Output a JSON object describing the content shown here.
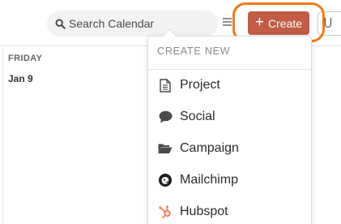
{
  "header": {
    "search": {
      "placeholder": "Search Calendar",
      "value": ""
    },
    "create_label": "Create"
  },
  "calendar": {
    "day_name": "FRIDAY",
    "day_date": "Jan 9"
  },
  "dropdown": {
    "title": "CREATE NEW",
    "items": [
      {
        "label": "Project",
        "icon": "document-icon"
      },
      {
        "label": "Social",
        "icon": "speech-bubble-icon"
      },
      {
        "label": "Campaign",
        "icon": "folder-icon"
      },
      {
        "label": "Mailchimp",
        "icon": "mailchimp-icon"
      },
      {
        "label": "Hubspot",
        "icon": "hubspot-icon",
        "color": "#ff7a59"
      }
    ]
  },
  "colors": {
    "create_button": "#c15c45",
    "highlight_ring": "#f07a1a",
    "hubspot": "#ff7a59"
  }
}
